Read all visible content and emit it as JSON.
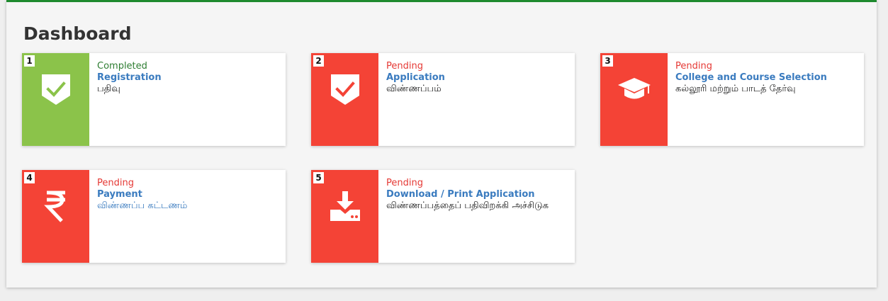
{
  "page": {
    "title": "Dashboard"
  },
  "cards": [
    {
      "number": "1",
      "status": "Completed",
      "name": "Registration",
      "subtitle": "பதிவு",
      "icon": "shield-check-icon"
    },
    {
      "number": "2",
      "status": "Pending",
      "name": "Application",
      "subtitle": "விண்ணப்பம்",
      "icon": "shield-check-icon"
    },
    {
      "number": "3",
      "status": "Pending",
      "name": "College and Course Selection",
      "subtitle": "கல்லூரி மற்றும் பாடத் தேர்வு",
      "icon": "graduation-cap-icon"
    },
    {
      "number": "4",
      "status": "Pending",
      "name": "Payment",
      "subtitle": "விண்ணப்ப கட்டணம்",
      "icon": "rupee-icon"
    },
    {
      "number": "5",
      "status": "Pending",
      "name": "Download / Print Application",
      "subtitle": "விண்ணப்பத்தைப் பதிவிறக்கி அச்சிடுக",
      "icon": "download-icon"
    }
  ],
  "colors": {
    "completed": "#8bc34a",
    "pending": "#f44336",
    "link": "#3a7bbf",
    "header_border": "#1e8a2e"
  }
}
